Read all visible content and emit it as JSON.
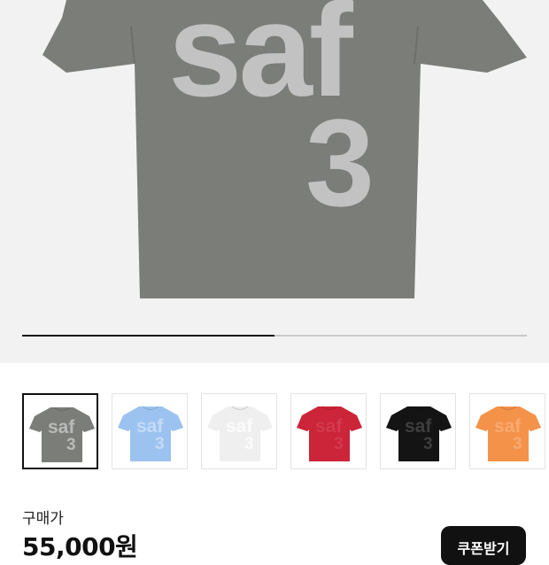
{
  "product_image": {
    "print_line1": "saf",
    "print_line2": "3",
    "shirt_color": "#7a7d78",
    "print_color": "#c2c2c2",
    "background": "#f2f2f2"
  },
  "gallery_progress": {
    "fraction": 0.5
  },
  "color_thumbnails": [
    {
      "color_name": "khaki-gray",
      "shirt_color": "#7a7d78",
      "print_color": "#b9bbb8",
      "print_line1": "saf",
      "print_line2": "3",
      "selected": true
    },
    {
      "color_name": "light-blue",
      "shirt_color": "#9cc3f0",
      "print_color": "#c4dbf6",
      "print_line1": "saf",
      "print_line2": "3",
      "selected": false
    },
    {
      "color_name": "white",
      "shirt_color": "#efefef",
      "print_color": "#fbfbfb",
      "print_line1": "saf",
      "print_line2": "3",
      "selected": false
    },
    {
      "color_name": "red",
      "shirt_color": "#cc2438",
      "print_color": "#d23a4d",
      "print_line1": "saf",
      "print_line2": "3",
      "selected": false
    },
    {
      "color_name": "black",
      "shirt_color": "#141414",
      "print_color": "#3e3e3e",
      "print_line1": "saf",
      "print_line2": "3",
      "selected": false
    },
    {
      "color_name": "orange",
      "shirt_color": "#f5924a",
      "print_color": "#f7aa70",
      "print_line1": "saf",
      "print_line2": "3",
      "selected": false
    }
  ],
  "price": {
    "label": "구매가",
    "value": "55,000원"
  },
  "coupon_button": {
    "label": "쿠폰받기"
  }
}
